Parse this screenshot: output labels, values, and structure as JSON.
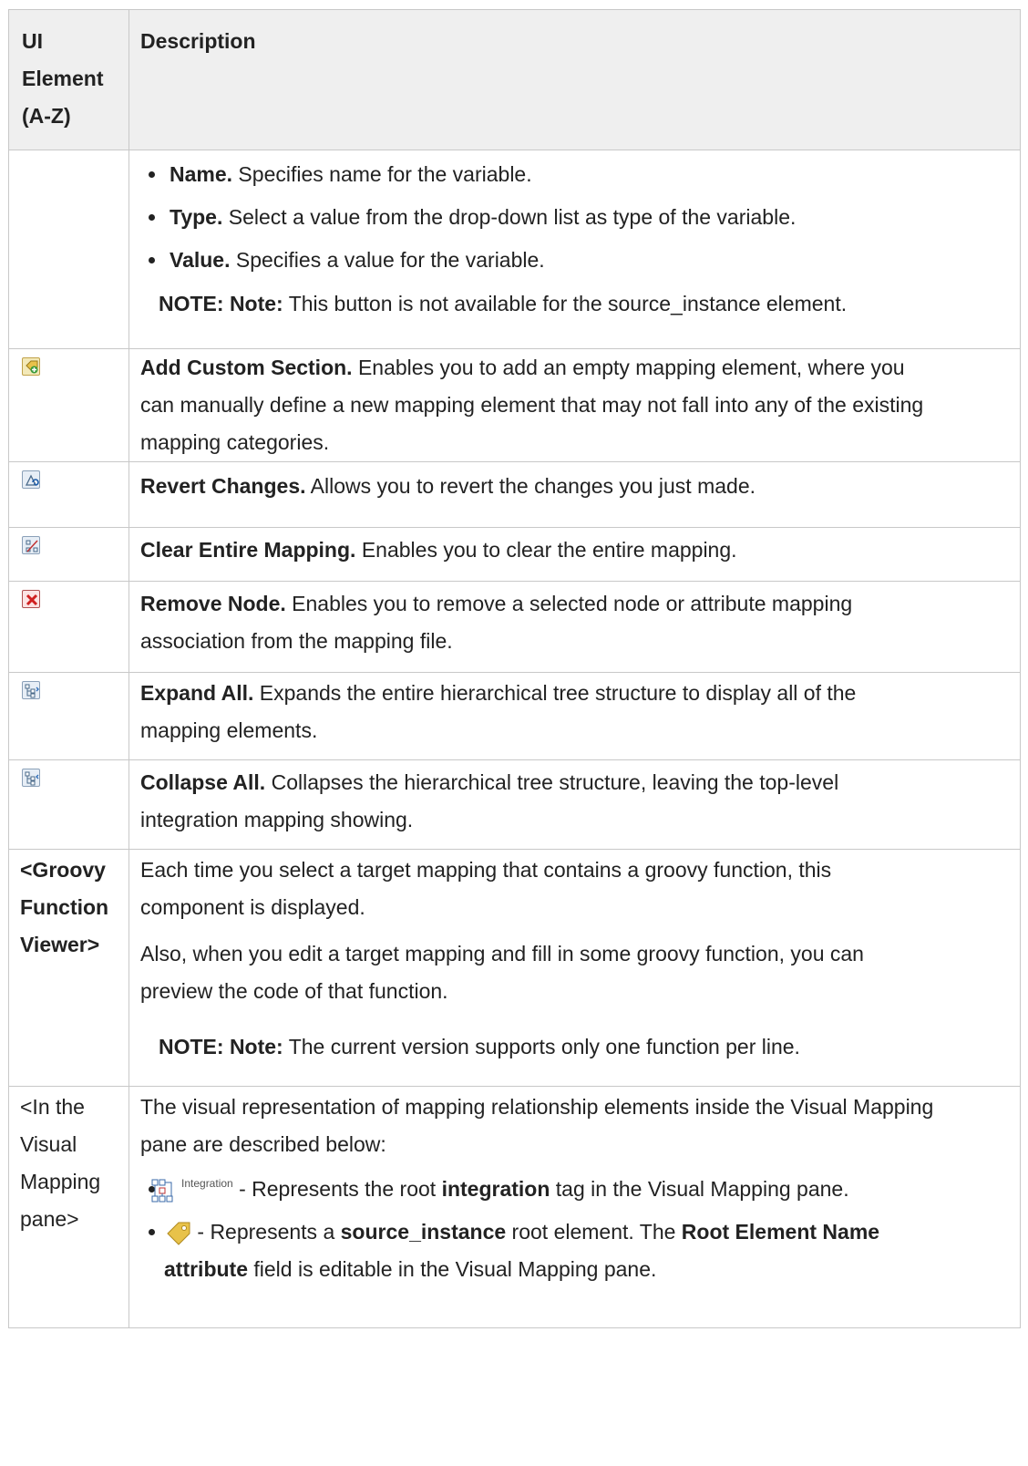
{
  "header": {
    "col1": [
      "UI",
      "Element",
      "(A-Z)"
    ],
    "col2": "Description"
  },
  "variables_row": {
    "bullets": [
      {
        "term": "Name.",
        "text": " Specifies name for the variable."
      },
      {
        "term": "Type.",
        "text": " Select a value from the drop-down list as type of the variable."
      },
      {
        "term": "Value.",
        "text": " Specifies a value for the variable."
      }
    ],
    "note": {
      "prefix": "NOTE: Note:",
      "text": " This button is not available for the source_instance element."
    }
  },
  "icon_rows": [
    {
      "icon": "add-custom-section-icon",
      "term": "Add Custom Section.",
      "lines": [
        " Enables you to add an empty mapping element, where you",
        "can manually define a new mapping element that may not fall into any of the existing",
        "mapping categories."
      ]
    },
    {
      "icon": "revert-changes-icon",
      "term": "Revert Changes.",
      "lines": [
        " Allows you to revert the changes you just made."
      ]
    },
    {
      "icon": "clear-entire-mapping-icon",
      "term": "Clear Entire Mapping.",
      "lines": [
        " Enables you to clear the entire mapping."
      ]
    },
    {
      "icon": "remove-node-icon",
      "term": "Remove Node.",
      "lines": [
        " Enables you to remove a selected node or attribute mapping",
        "association from the mapping file."
      ]
    },
    {
      "icon": "expand-all-icon",
      "term": "Expand All.",
      "lines": [
        " Expands the entire hierarchical tree structure to display all of the",
        "mapping elements."
      ]
    },
    {
      "icon": "collapse-all-icon",
      "term": "Collapse All.",
      "lines": [
        " Collapses the hierarchical tree structure, leaving the top-level",
        "integration mapping showing."
      ]
    }
  ],
  "groovy_row": {
    "element": [
      "<Groovy",
      "Function",
      "Viewer>"
    ],
    "para1": [
      "Each time you select a target mapping that contains a groovy function, this",
      "component is displayed."
    ],
    "para2": [
      "Also, when you edit a target mapping and fill in some groovy function, you can",
      "preview the code of that function."
    ],
    "note": {
      "prefix": "NOTE: Note:",
      "text": " The current version supports only one function per line."
    }
  },
  "visual_row": {
    "element": [
      "<In the",
      "Visual",
      "Mapping",
      "pane>"
    ],
    "intro": [
      "The visual representation of mapping relationship elements inside the Visual Mapping",
      "pane are described below:"
    ],
    "integration": {
      "icon_label": "Integration",
      "pre": " - Represents the root ",
      "bold": "integration",
      "post": " tag in the Visual Mapping pane."
    },
    "source": {
      "pre": " - Represents a ",
      "bold1": "source_instance",
      "mid": " root element. The ",
      "bold2a": "Root Element Name",
      "bold2b": "attribute",
      "post": " field is editable in the Visual Mapping pane."
    }
  }
}
